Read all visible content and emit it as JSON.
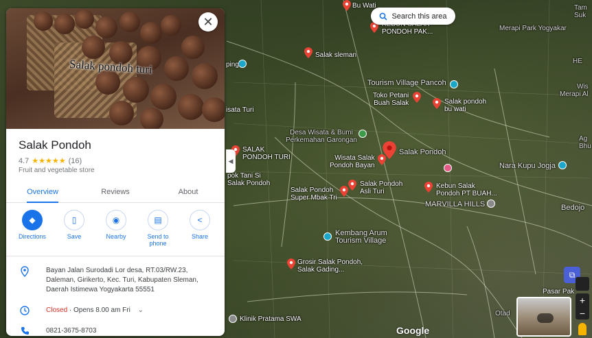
{
  "map": {
    "search_area_label": "Search this area",
    "google_logo": "Google",
    "labels": [
      {
        "id": "bu-wati-top",
        "text": "Bu Wati"
      },
      {
        "id": "kebun-salak-top",
        "text": "KEBUN SALAK\nPONDOH PAK..."
      },
      {
        "id": "salak-sleman",
        "text": "Salak sleman"
      },
      {
        "id": "tourism-pancoh",
        "text": "Tourism Village Pancoh"
      },
      {
        "id": "toko-petani",
        "text": "Toko Petani\nBuah Salak"
      },
      {
        "id": "salak-bu-wati",
        "text": "Salak pondoh\nbu wati"
      },
      {
        "id": "desa-wisata",
        "text": "Desa Wisata & Bumi\nPerkemahan Garongan"
      },
      {
        "id": "salak-pondoh-turi",
        "text": "SALAK\nPONDOH TURI"
      },
      {
        "id": "wisata-salak-bayan",
        "text": "Wisata Salak\nPondoh Bayan"
      },
      {
        "id": "salak-pondoh-main",
        "text": "Salak Pondoh"
      },
      {
        "id": "tani-si-salak",
        "text": "pok Tani Si\nSalak Pondoh"
      },
      {
        "id": "salak-asli-turi",
        "text": "Salak Pondoh\nAsli Turi"
      },
      {
        "id": "super-mbak-tri",
        "text": "Salak Pondoh\nSuper Mbak Tri"
      },
      {
        "id": "kebun-pt-buah",
        "text": "Kebun Salak\nPondoh PT BUAH..."
      },
      {
        "id": "marvilla",
        "text": "MARVILLA HILLS"
      },
      {
        "id": "nara-kupu",
        "text": "Nara Kupu Jogja"
      },
      {
        "id": "bedojo",
        "text": "Bedojo"
      },
      {
        "id": "kembang-arum",
        "text": "Kembang Arum\nTourism Village"
      },
      {
        "id": "grosir-salak",
        "text": "Grosir Salak Pondoh,\nSalak Gading..."
      },
      {
        "id": "klinik-swa",
        "text": "Klinik Pratama SWA"
      },
      {
        "id": "wisata-turi",
        "text": "isata Turi"
      },
      {
        "id": "ping-left",
        "text": "ping"
      },
      {
        "id": "merapi-park",
        "text": "Merapi Park Yogyakar"
      },
      {
        "id": "tam",
        "text": "Tam\nSuk"
      },
      {
        "id": "wisa",
        "text": "Wis\nMerapi Al"
      },
      {
        "id": "he",
        "text": "HE"
      },
      {
        "id": "ag",
        "text": "Ag\nBhu"
      },
      {
        "id": "pasar",
        "text": "Pasar Pak"
      },
      {
        "id": "otad",
        "text": "Otad"
      }
    ]
  },
  "panel": {
    "hero_caption": "Salak pondoh turi",
    "close_glyph": "✕",
    "title": "Salak Pondoh",
    "rating": "4.7",
    "stars": "★★★★★",
    "review_count": "(16)",
    "category": "Fruit and vegetable store",
    "tabs": [
      {
        "label": "Overview",
        "active": true
      },
      {
        "label": "Reviews",
        "active": false
      },
      {
        "label": "About",
        "active": false
      }
    ],
    "actions": [
      {
        "label": "Directions",
        "icon": "directions-icon",
        "glyph": "◆"
      },
      {
        "label": "Save",
        "icon": "bookmark-icon",
        "glyph": "▯"
      },
      {
        "label": "Nearby",
        "icon": "nearby-icon",
        "glyph": "◉"
      },
      {
        "label": "Send to\nphone",
        "icon": "phone-send-icon",
        "glyph": "▤"
      },
      {
        "label": "Share",
        "icon": "share-icon",
        "glyph": "<"
      }
    ],
    "address": "Bayan Jalan Surodadi Lor desa, RT.03/RW.23, Daleman, Girikerto, Kec. Turi, Kabupaten Sleman, Daerah Istimewa Yogyakarta 55551",
    "hours_status": "Closed",
    "hours_detail": " · Opens 8.00 am Fri",
    "phone": "0821-3675-8703"
  },
  "colors": {
    "accent": "#1a73e8",
    "closed": "#d93025",
    "star": "#f5b400",
    "pin": "#ea4335"
  }
}
